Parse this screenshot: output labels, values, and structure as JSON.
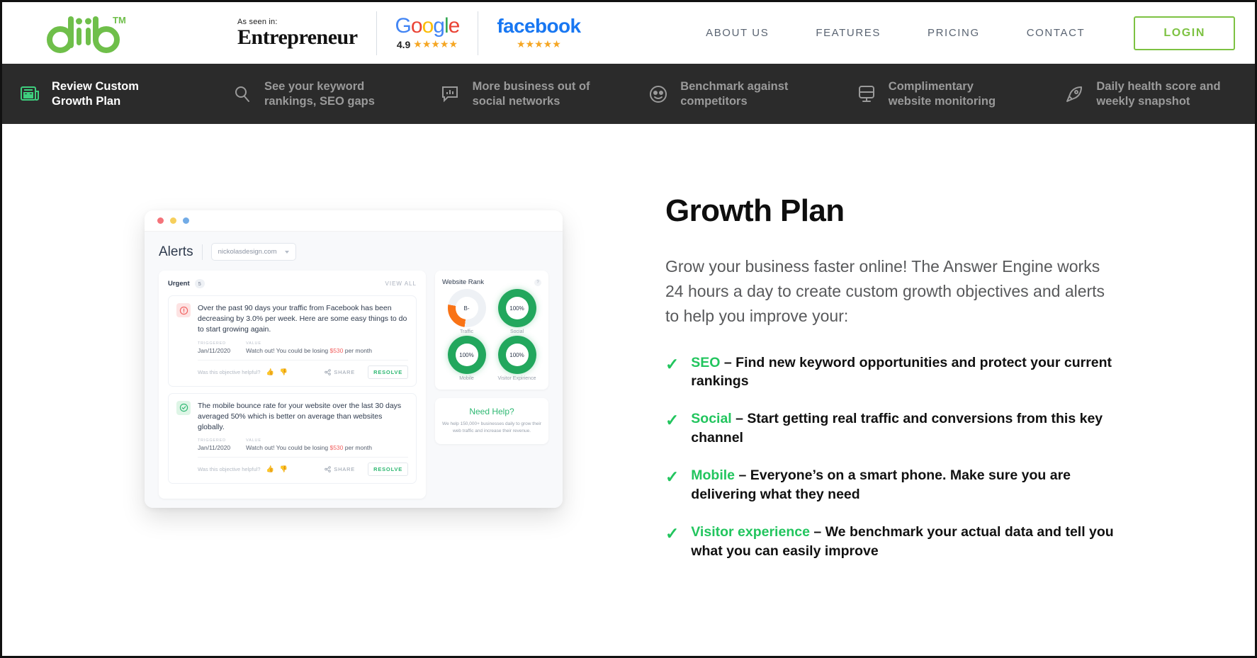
{
  "brand": {
    "logo_text": "diib",
    "trademark": "TM",
    "logo_color": "#6fbf4a"
  },
  "header": {
    "as_seen_in_label": "As seen in:",
    "press_badge": "Entrepreneur",
    "google": {
      "name": "Google",
      "letters": [
        "G",
        "o",
        "o",
        "g",
        "l",
        "e"
      ],
      "rating": "4.9",
      "stars": "★★★★★"
    },
    "facebook": {
      "name": "facebook",
      "stars": "★★★★★"
    },
    "nav": [
      {
        "label": "ABOUT US",
        "name": "nav-about-us"
      },
      {
        "label": "FEATURES",
        "name": "nav-features"
      },
      {
        "label": "PRICING",
        "name": "nav-pricing"
      },
      {
        "label": "CONTACT",
        "name": "nav-contact"
      }
    ],
    "login_label": "LOGIN",
    "login_color": "#7dc242"
  },
  "feature_bar": {
    "background": "#2b2b2b",
    "active_color": "#ffffff",
    "inactive_color": "#9a9a9a",
    "active_icon_color": "#3ecf7e",
    "items": [
      {
        "icon": "report-icon",
        "line1": "Review Custom",
        "line2": "Growth Plan",
        "active": true
      },
      {
        "icon": "search-icon",
        "line1": "See your keyword",
        "line2": "rankings, SEO gaps",
        "active": false
      },
      {
        "icon": "social-chart-icon",
        "line1": "More business out of",
        "line2": "social networks",
        "active": false
      },
      {
        "icon": "nerd-face-icon",
        "line1": "Benchmark against",
        "line2": "competitors",
        "active": false
      },
      {
        "icon": "monitor-icon",
        "line1": "Complimentary",
        "line2": "website monitoring",
        "active": false
      },
      {
        "icon": "rocket-icon",
        "line1": "Daily health score and",
        "line2": "weekly snapshot",
        "active": false
      }
    ]
  },
  "content": {
    "title": "Growth Plan",
    "intro": "Grow your business faster online! The Answer Engine works 24 hours a day to create custom growth objectives and alerts to help you improve your:",
    "check_glyph": "✓",
    "accent_color": "#22c55e",
    "bullets": [
      {
        "keyword": "SEO",
        "dash": " – ",
        "text": "Find new keyword opportunities and protect your current rankings"
      },
      {
        "keyword": "Social",
        "dash": " – ",
        "text": "Start getting real traffic and conversions from this key channel"
      },
      {
        "keyword": "Mobile",
        "dash": " – ",
        "text": "Everyone’s on a smart phone. Make sure you are delivering what they need"
      },
      {
        "keyword": "Visitor experience",
        "dash": " – ",
        "text": "We benchmark your actual data and tell you what you can easily improve"
      }
    ]
  },
  "mockup": {
    "window_dots": [
      "red",
      "yellow",
      "blue"
    ],
    "page_title": "Alerts",
    "site_selector": "nickolasdesign.com",
    "urgent_label": "Urgent",
    "urgent_count": "5",
    "view_all": "VIEW ALL",
    "alerts": [
      {
        "status": "urgent",
        "icon": "exclamation-circle-icon",
        "icon_glyph": "!",
        "message": "Over the past 90 days your traffic from Facebook has been decreasing by 3.0% per week. Here are some easy things to do to start growing again.",
        "triggered_label": "TRIGGERED",
        "triggered_value": "Jan/11/2020",
        "value_label": "VALUE",
        "value_prefix": "Watch out! You could be losing ",
        "value_money": "$530",
        "value_suffix": " per month",
        "helpful_question": "Was this objective helpful?",
        "thumbs_up": "ὄd",
        "share_label": "SHARE",
        "resolve_label": "RESOLVE"
      },
      {
        "status": "ok",
        "icon": "check-circle-icon",
        "icon_glyph": "✓",
        "message": "The mobile bounce rate for your website over the last 30 days averaged 50% which is better on average than websites globally.",
        "triggered_label": "TRIGGERED",
        "triggered_value": "Jan/11/2020",
        "value_label": "VALUE",
        "value_prefix": "Watch out! You could be losing ",
        "value_money": "$530",
        "value_suffix": " per month",
        "helpful_question": "Was this objective helpful?",
        "share_label": "SHARE",
        "resolve_label": "RESOLVE"
      }
    ],
    "website_rank": {
      "title": "Website Rank",
      "help_glyph": "?",
      "metrics": [
        {
          "label": "Traffic",
          "value": "B-",
          "percent": 26,
          "color": "#f97316",
          "full": false
        },
        {
          "label": "Social",
          "value": "100%",
          "percent": 100,
          "color": "#22a75d",
          "full": true
        },
        {
          "label": "Mobile",
          "value": "100%",
          "percent": 100,
          "color": "#22a75d",
          "full": true
        },
        {
          "label": "Visitor Expirience",
          "value": "100%",
          "percent": 100,
          "color": "#22a75d",
          "full": true
        }
      ]
    },
    "need_help": {
      "title": "Need Help?",
      "text": "We help 150,000+ businesses daily to grow their web traffic and increase their revenue."
    }
  }
}
